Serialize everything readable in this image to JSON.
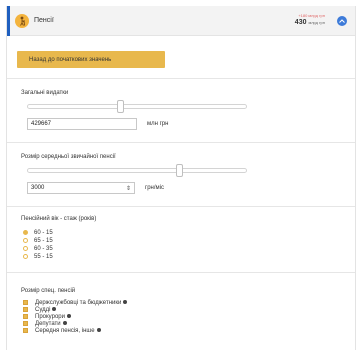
{
  "header": {
    "title": "Пенсії",
    "sum_label": "+180 млрд грн",
    "sum_value": "430",
    "sum_unit": "млрд грн"
  },
  "reset_button": "Назад до початкових значень",
  "total_expenses": {
    "label": "Загальні видатки",
    "value": "429667",
    "unit": "млн грн",
    "slider_fraction": 0.42
  },
  "avg_pension": {
    "label": "Розмір середньої звичайної пенсії",
    "value": "3000",
    "unit": "грн/міс",
    "slider_fraction": 0.68
  },
  "retirement_age": {
    "label": "Пенсійний вік - стаж (років)",
    "options": [
      "60 - 15",
      "65 - 15",
      "60 - 35",
      "55 - 15"
    ],
    "selected_index": 0
  },
  "special_pensions": {
    "label": "Розмір спец. пенсій",
    "items": [
      "Держслужбовці та бюджетники",
      "Судді",
      "Прокурори",
      "Депутати",
      "Середня пенсія, інше"
    ]
  }
}
